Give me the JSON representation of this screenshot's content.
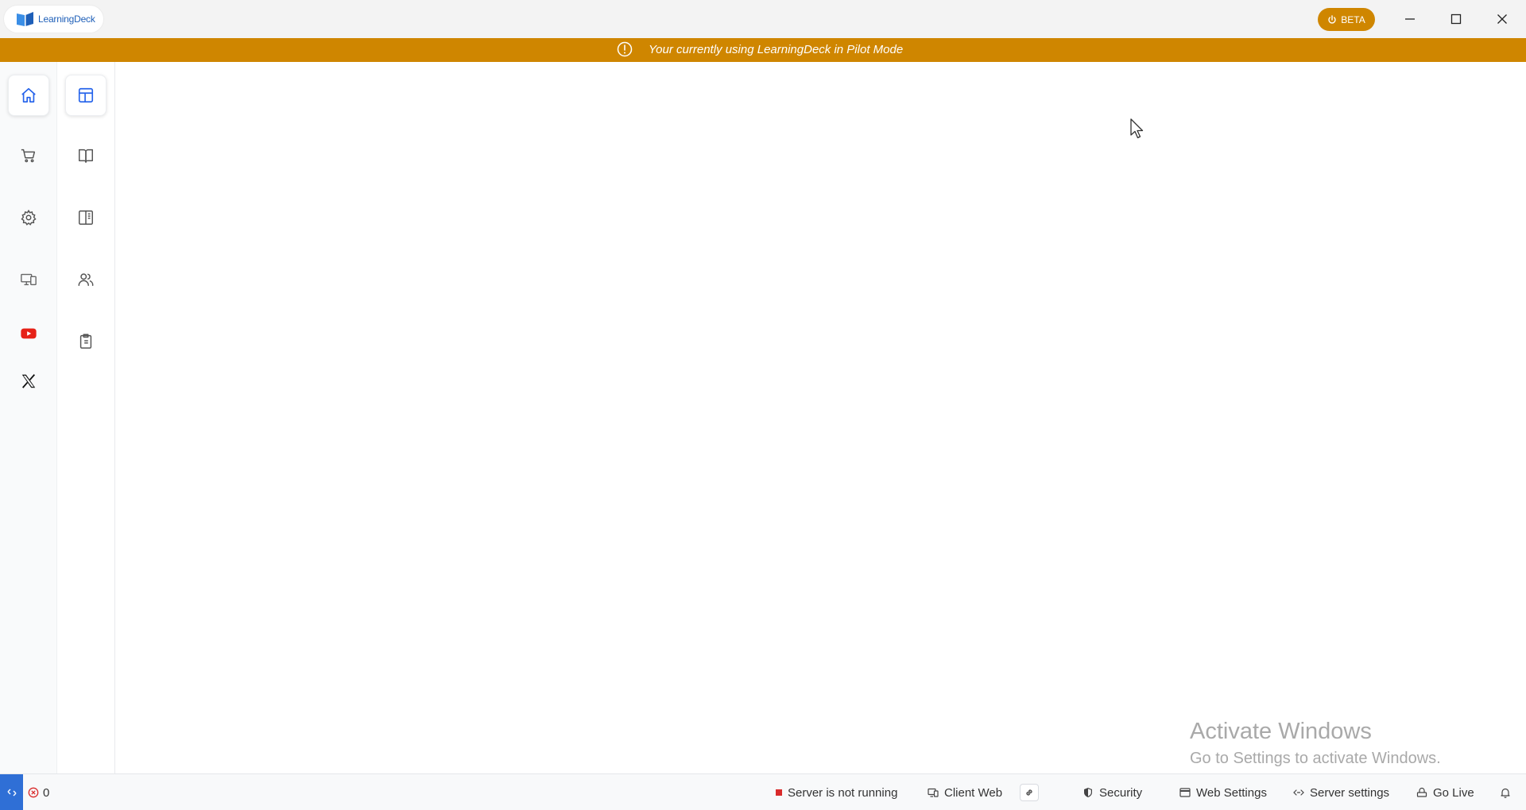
{
  "app": {
    "name": "LearningDeck",
    "beta_label": "BETA"
  },
  "banner": {
    "message": "Your currently using LearningDeck in Pilot Mode"
  },
  "primary_nav": [
    {
      "icon": "home-icon",
      "active": true
    },
    {
      "icon": "cart-icon",
      "active": false
    },
    {
      "icon": "gear-icon",
      "active": false
    },
    {
      "icon": "devices-icon",
      "active": false
    },
    {
      "icon": "youtube-icon",
      "active": false
    },
    {
      "icon": "x-logo-icon",
      "active": false
    }
  ],
  "secondary_nav": [
    {
      "icon": "layout-icon",
      "active": true
    },
    {
      "icon": "book-open-icon",
      "active": false
    },
    {
      "icon": "book-sidebar-icon",
      "active": false
    },
    {
      "icon": "users-icon",
      "active": false
    },
    {
      "icon": "clipboard-icon",
      "active": false
    }
  ],
  "watermark": {
    "line1": "Activate Windows",
    "line2": "Go to Settings to activate Windows."
  },
  "statusbar": {
    "error_count": "0",
    "server_status": "Server is not running",
    "client_web": "Client Web",
    "security": "Security",
    "web_settings": "Web Settings",
    "server_settings": "Server settings",
    "go_live": "Go Live"
  },
  "colors": {
    "accent": "#cf8600",
    "brand_blue": "#1e5fb8",
    "remote_blue": "#2f6fd6",
    "error_red": "#d92b2b"
  }
}
